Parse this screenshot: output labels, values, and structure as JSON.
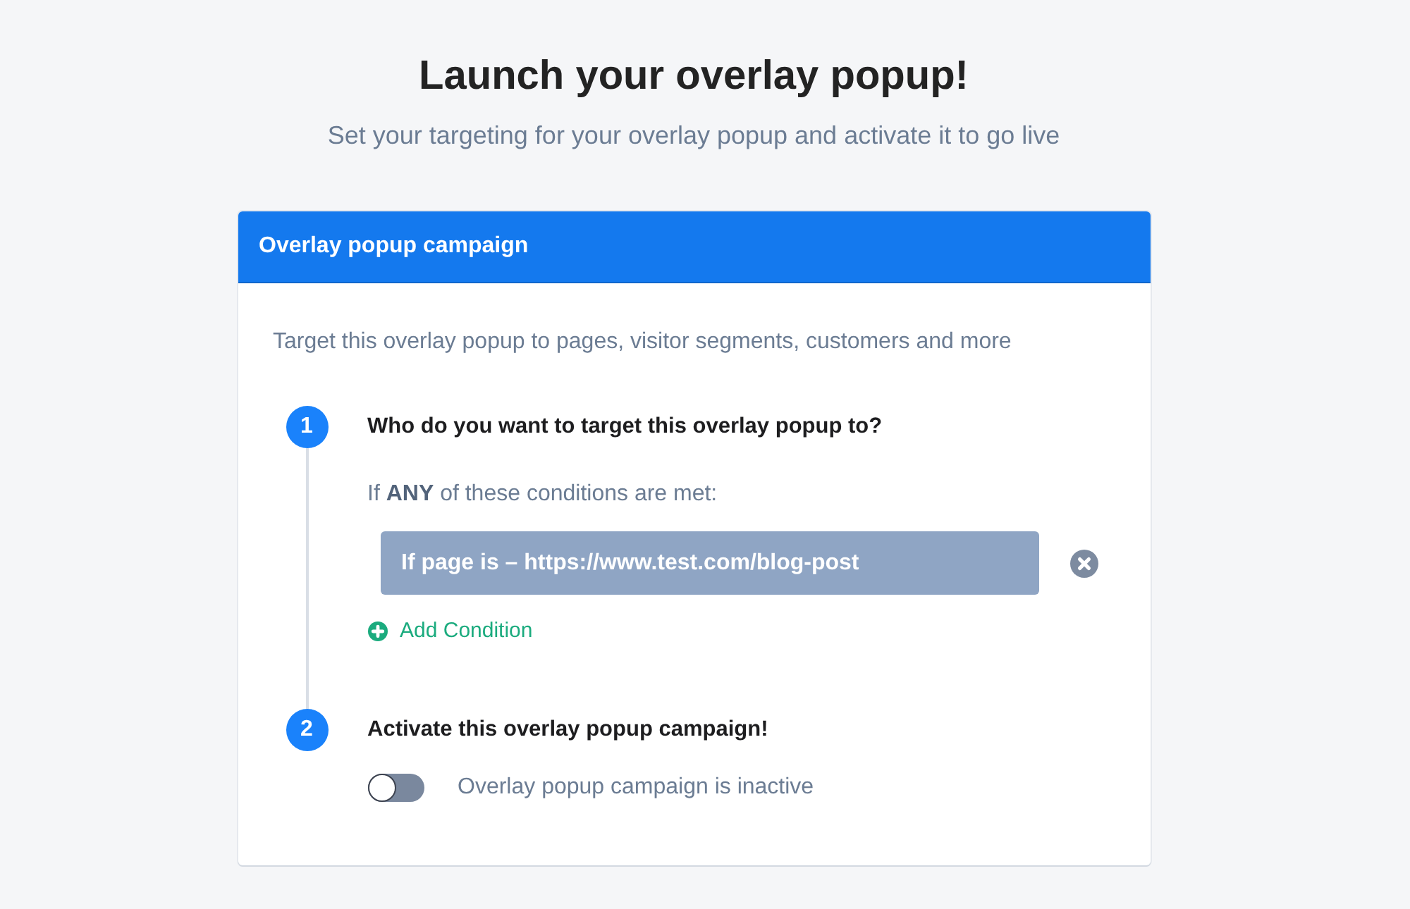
{
  "header": {
    "title": "Launch your overlay popup!",
    "subtitle": "Set your targeting for your overlay popup and activate it to go live"
  },
  "card": {
    "title": "Overlay popup campaign",
    "description": "Target this overlay popup to pages, visitor segments, customers and more",
    "steps": [
      {
        "kind": "conditions",
        "number": "1",
        "title": "Who do you want to target this overlay popup to?",
        "match_text": "If **ANY** of these conditions are met:",
        "conditions": [
          {
            "text": "If page is – https://www.test.com/blog-post"
          }
        ],
        "add_label": "Add Condition"
      },
      {
        "kind": "activation",
        "number": "2",
        "title": "Activate this overlay popup campaign!",
        "toggle": {
          "on": false,
          "label": "Overlay popup campaign is inactive"
        }
      }
    ]
  }
}
